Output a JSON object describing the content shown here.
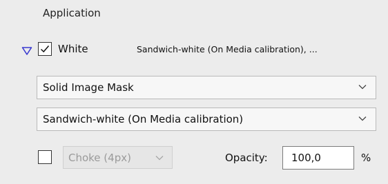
{
  "section": {
    "title": "Application"
  },
  "white": {
    "checked": true,
    "label": "White",
    "summary": "Sandwich-white (On Media calibration), ..."
  },
  "mask_select": {
    "value": "Solid Image Mask"
  },
  "calibration_select": {
    "value": "Sandwich-white (On Media calibration)"
  },
  "choke": {
    "checked": false,
    "value": "Choke (4px)",
    "enabled": false
  },
  "opacity": {
    "label": "Opacity:",
    "value": "100,0",
    "unit": "%"
  },
  "icons": {
    "expand": "triangle-down-icon",
    "checkmark": "checkmark-icon",
    "dropdown": "chevron-down-icon"
  },
  "colors": {
    "expand_triangle": "#3a3ad0",
    "panel_background": "#ececec"
  }
}
